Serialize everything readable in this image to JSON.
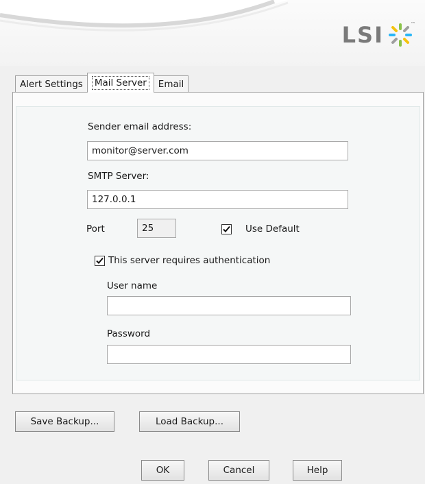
{
  "brand": {
    "logo_text": "LSI",
    "trademark": "™"
  },
  "tabs": [
    {
      "label": "Alert Settings",
      "active": false
    },
    {
      "label": "Mail Server",
      "active": true
    },
    {
      "label": "Email",
      "active": false
    }
  ],
  "mail_server": {
    "sender_label": "Sender email address:",
    "sender_value": "monitor@server.com",
    "smtp_label": "SMTP Server:",
    "smtp_value": "127.0.0.1",
    "port_label": "Port",
    "port_value": "25",
    "use_default_label": "Use Default",
    "use_default_checked": true,
    "auth_label": "This server requires authentication",
    "auth_checked": true,
    "username_label": "User name",
    "username_value": "",
    "password_label": "Password",
    "password_value": ""
  },
  "backup": {
    "save_label": "Save Backup...",
    "load_label": "Load Backup..."
  },
  "dialog_buttons": {
    "ok_label": "OK",
    "cancel_label": "Cancel",
    "help_label": "Help"
  }
}
